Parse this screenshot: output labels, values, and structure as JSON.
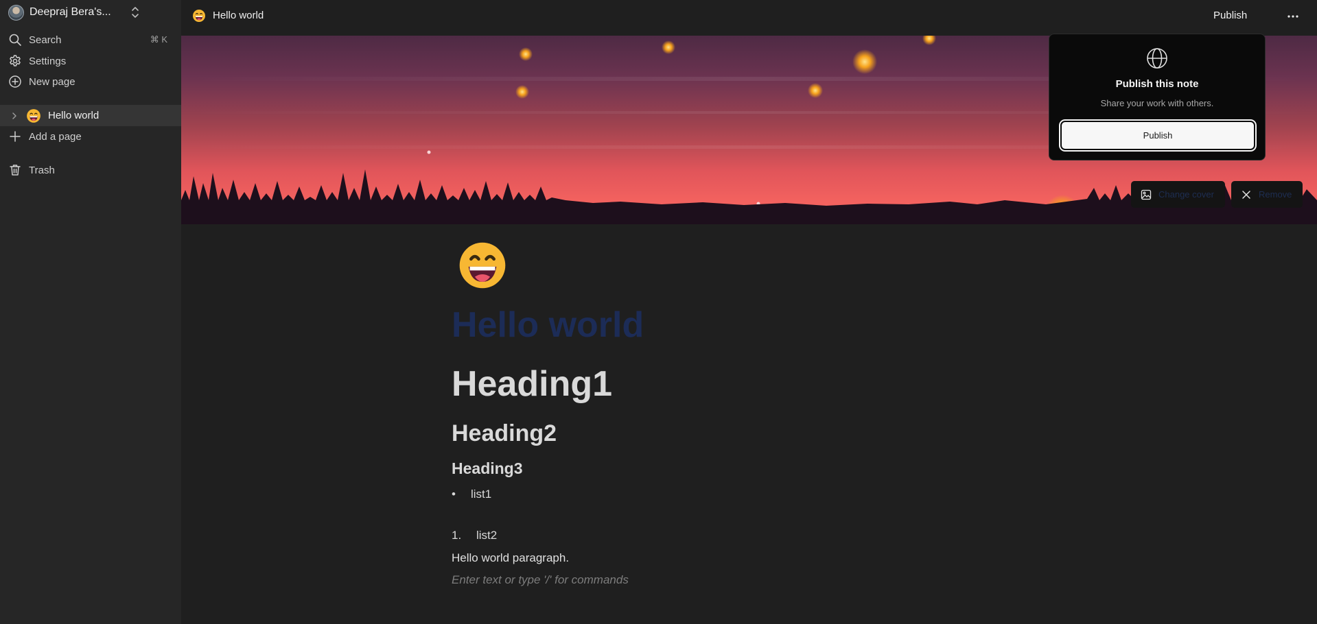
{
  "sidebar": {
    "workspace_name": "Deepraj Bera's...",
    "search_label": "Search",
    "search_shortcut": "⌘ K",
    "settings_label": "Settings",
    "new_page_label": "New page",
    "pages": [
      {
        "title": "Hello world"
      }
    ],
    "add_page_label": "Add a page",
    "trash_label": "Trash"
  },
  "topbar": {
    "title": "Hello world",
    "publish_label": "Publish"
  },
  "popover": {
    "title": "Publish this note",
    "subtitle": "Share your work with others.",
    "button_label": "Publish"
  },
  "cover": {
    "change_label": "Change cover",
    "remove_label": "Remove"
  },
  "document": {
    "title": "Hello world",
    "heading1": "Heading1",
    "heading2": "Heading2",
    "heading3": "Heading3",
    "bullet_marker": "•",
    "bullet_item": "list1",
    "ordered_marker": "1.",
    "ordered_item": "list2",
    "paragraph": "Hello world paragraph.",
    "placeholder": "Enter text or type '/' for commands"
  },
  "colors": {
    "sidebar_bg": "#262626",
    "main_bg": "#1f1f1f",
    "title_color": "#1c2c57",
    "popover_bg": "#0a0a0a"
  }
}
